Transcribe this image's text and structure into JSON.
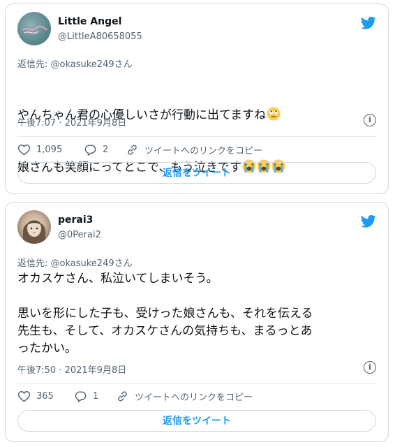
{
  "tweets": [
    {
      "display_name": "Little Angel",
      "handle": "@LittleA80658055",
      "reply_to": "返信先: @okasuke249さん",
      "text_line1": "やんちゃん君の心優しいさが行動に出てますね",
      "text_line2": "娘さんも笑顔にってとこで、もう泣きです",
      "timestamp": "午後7:07 · 2021年9月8日",
      "likes": "1,095",
      "replies": "2",
      "copy_link": "ツイートへのリンクをコピー",
      "reply_button": "返信をツイート"
    },
    {
      "display_name": "perai3",
      "handle": "@0Perai2",
      "reply_to": "返信先: @okasuke249さん",
      "text": "オカスケさん、私泣いてしまいそう。\n\n思いを形にした子も、受けった娘さんも、それを伝える\n先生も、そして、オカスケさんの気持ちも、まるっとあ\nったかい。",
      "timestamp": "午後7:50 · 2021年9月8日",
      "likes": "365",
      "replies": "1",
      "copy_link": "ツイートへのリンクをコピー",
      "reply_button": "返信をツイート"
    }
  ],
  "colors": {
    "brand_blue": "#1d9bf0",
    "text_primary": "#0f1419",
    "text_secondary": "#536471",
    "border": "#cfd9de"
  },
  "icons": [
    "twitter-bird-icon",
    "info-icon",
    "heart-icon",
    "reply-icon",
    "link-icon",
    "face-with-rolling-eyes-emoji",
    "loudly-crying-face-emoji"
  ]
}
